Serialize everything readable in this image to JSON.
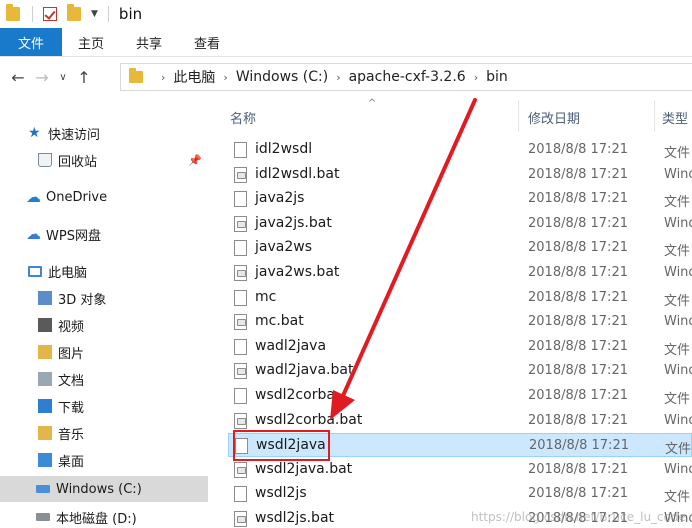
{
  "window": {
    "title": "bin"
  },
  "ribbon": {
    "tabs": [
      "文件",
      "主页",
      "共享",
      "查看"
    ]
  },
  "address": {
    "crumbs": [
      "此电脑",
      "Windows (C:)",
      "apache-cxf-3.2.6",
      "bin"
    ]
  },
  "sidebar": {
    "items": [
      {
        "label": "快速访问",
        "icon": "star-icon"
      },
      {
        "label": "回收站",
        "icon": "recycle-bin-icon"
      },
      {
        "label": "OneDrive",
        "icon": "cloud-icon"
      },
      {
        "label": "WPS网盘",
        "icon": "cloud-outline-icon"
      },
      {
        "label": "此电脑",
        "icon": "computer-icon"
      },
      {
        "label": "3D 对象",
        "icon": "3d-objects-icon"
      },
      {
        "label": "视频",
        "icon": "video-icon"
      },
      {
        "label": "图片",
        "icon": "pictures-icon"
      },
      {
        "label": "文档",
        "icon": "documents-icon"
      },
      {
        "label": "下载",
        "icon": "download-icon"
      },
      {
        "label": "音乐",
        "icon": "music-icon"
      },
      {
        "label": "桌面",
        "icon": "desktop-icon"
      },
      {
        "label": "Windows (C:)",
        "icon": "drive-icon"
      },
      {
        "label": "本地磁盘 (D:)",
        "icon": "drive-icon"
      }
    ]
  },
  "columns": {
    "name": "名称",
    "date": "修改日期",
    "type": "类型"
  },
  "files": [
    {
      "name": "idl2wsdl",
      "date": "2018/8/8 17:21",
      "type": "文件",
      "kind": "file"
    },
    {
      "name": "idl2wsdl.bat",
      "date": "2018/8/8 17:21",
      "type": "Wind",
      "kind": "bat"
    },
    {
      "name": "java2js",
      "date": "2018/8/8 17:21",
      "type": "文件",
      "kind": "file"
    },
    {
      "name": "java2js.bat",
      "date": "2018/8/8 17:21",
      "type": "Wind",
      "kind": "bat"
    },
    {
      "name": "java2ws",
      "date": "2018/8/8 17:21",
      "type": "文件",
      "kind": "file"
    },
    {
      "name": "java2ws.bat",
      "date": "2018/8/8 17:21",
      "type": "Wind",
      "kind": "bat"
    },
    {
      "name": "mc",
      "date": "2018/8/8 17:21",
      "type": "文件",
      "kind": "file"
    },
    {
      "name": "mc.bat",
      "date": "2018/8/8 17:21",
      "type": "Wind",
      "kind": "bat"
    },
    {
      "name": "wadl2java",
      "date": "2018/8/8 17:21",
      "type": "文件",
      "kind": "file"
    },
    {
      "name": "wadl2java.bat",
      "date": "2018/8/8 17:21",
      "type": "Wind",
      "kind": "bat"
    },
    {
      "name": "wsdl2corba",
      "date": "2018/8/8 17:21",
      "type": "文件",
      "kind": "file"
    },
    {
      "name": "wsdl2corba.bat",
      "date": "2018/8/8 17:21",
      "type": "Wind",
      "kind": "bat"
    },
    {
      "name": "wsdl2java",
      "date": "2018/8/8 17:21",
      "type": "文件",
      "kind": "file",
      "selected": true
    },
    {
      "name": "wsdl2java.bat",
      "date": "2018/8/8 17:21",
      "type": "Wind",
      "kind": "bat"
    },
    {
      "name": "wsdl2js",
      "date": "2018/8/8 17:21",
      "type": "文件",
      "kind": "file"
    },
    {
      "name": "wsdl2js.bat",
      "date": "2018/8/8 17:21",
      "type": "Wind",
      "kind": "bat"
    }
  ],
  "watermark": "https://blog.csdn.net/Bruce_lu_code",
  "colors": {
    "accent": "#1979ca",
    "selection": "#cce8ff",
    "annotation": "#e11b22"
  }
}
